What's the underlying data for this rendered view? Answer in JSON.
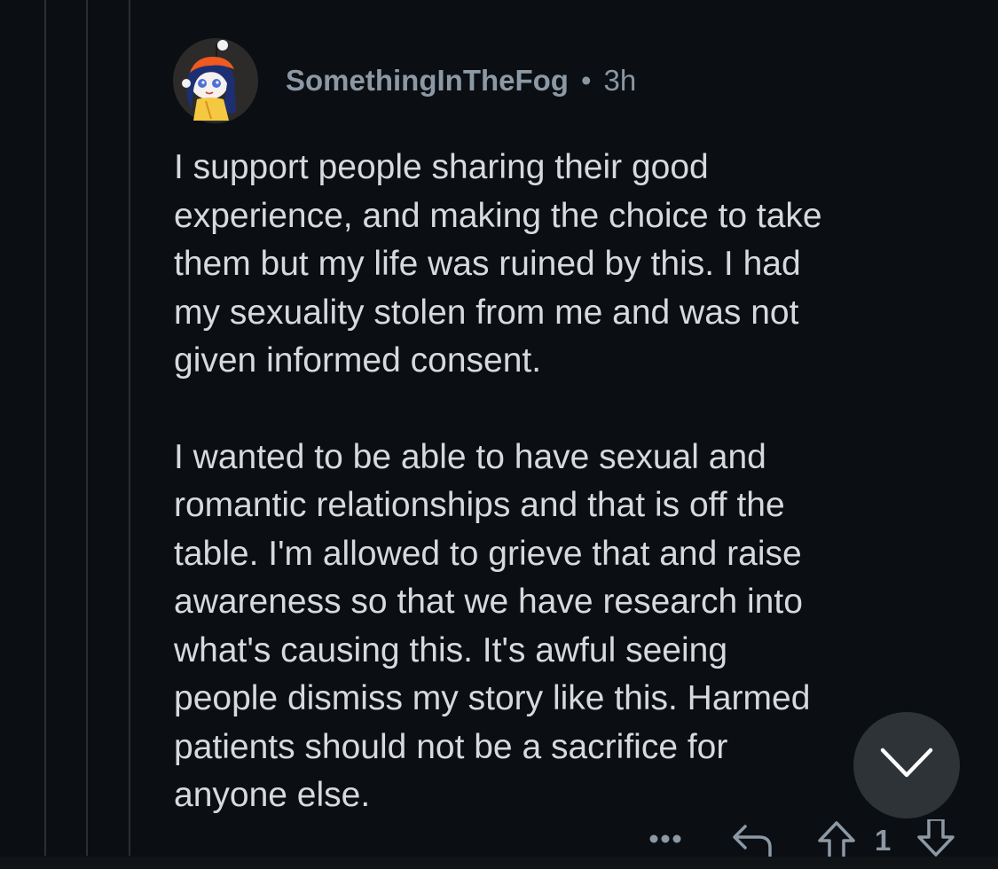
{
  "comment": {
    "username": "SomethingInTheFog",
    "separator": "•",
    "time_ago": "3h",
    "paragraphs": [
      "I support people sharing their good\nexperience, and making the choice to take\nthem but my life was ruined by this. I had\nmy sexuality stolen from me and was not\ngiven informed consent.",
      "I wanted to be able to have sexual and\nromantic relationships and that is off the\ntable. I'm allowed to grieve that and raise\nawareness so that we have research into\nwhat's causing this. It's awful seeing\npeople dismiss my story like this. Harmed\npatients should not be a sacrifice for\nanyone else."
    ]
  },
  "actions": {
    "more_icon": "more-options-icon",
    "reply_icon": "reply-icon",
    "upvote_icon": "upvote-arrow-icon",
    "vote_count": "1",
    "downvote_icon": "downvote-arrow-icon"
  },
  "scroll_button": {
    "icon": "chevron-down-icon"
  },
  "colors": {
    "background": "#0b0e12",
    "text": "#d7dadc",
    "meta_text": "#8c98a4",
    "thread_line": "#2a2f35",
    "scroll_button_bg": "#2e3337"
  }
}
